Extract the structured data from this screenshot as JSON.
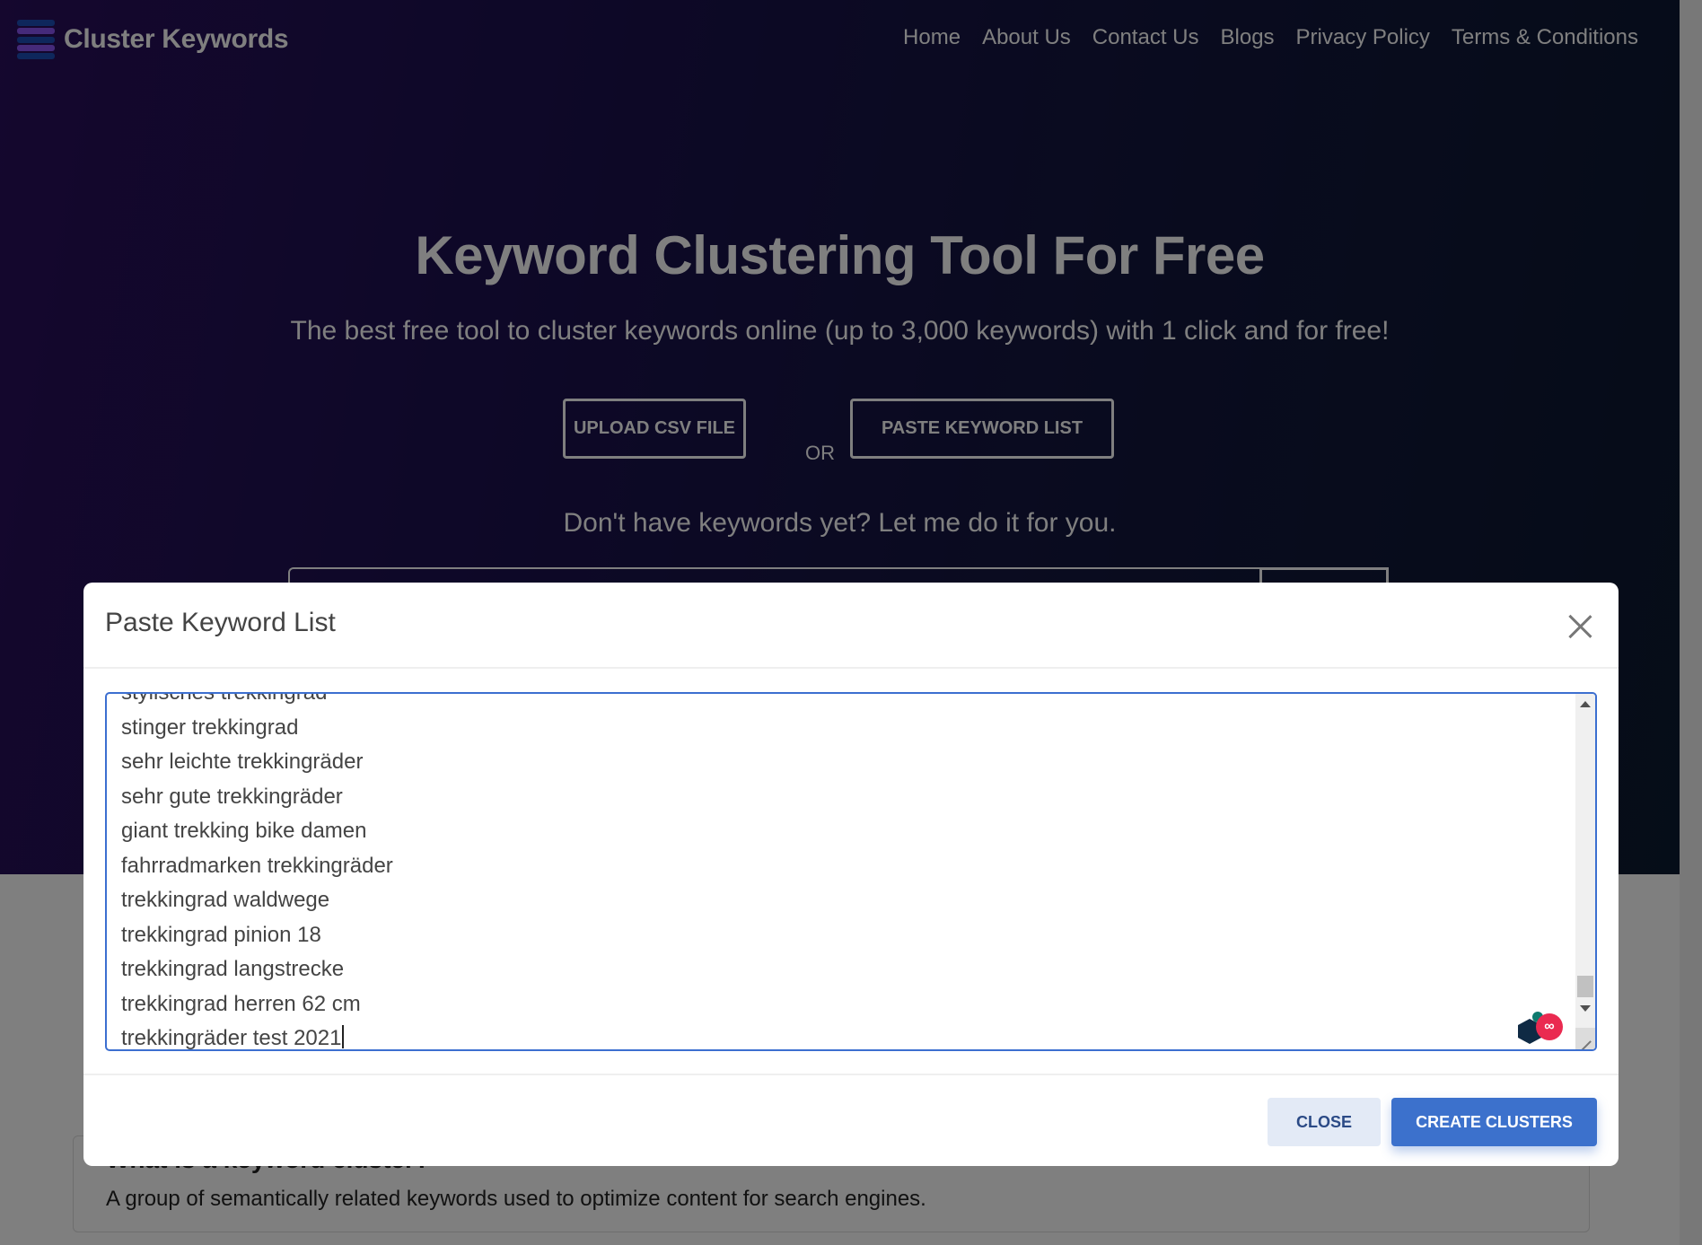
{
  "site": {
    "logo_text": "Cluster Keywords",
    "nav": [
      "Home",
      "About Us",
      "Contact Us",
      "Blogs",
      "Privacy Policy",
      "Terms & Conditions"
    ]
  },
  "hero": {
    "title": "Keyword Clustering Tool For Free",
    "subtitle": "The best free tool to cluster keywords online (up to 3,000 keywords) with 1 click and for free!",
    "upload_label": "UPLOAD CSV FILE",
    "or_label": "OR",
    "paste_label": "PASTE KEYWORD LIST",
    "prompt": "Don't have keywords yet? Let me do it for you."
  },
  "info_card": {
    "title": "What is a keyword cluster?",
    "text": "A group of semantically related keywords used to optimize content for search engines."
  },
  "modal": {
    "title": "Paste Keyword List",
    "keywords": [
      "stylisches trekkingrad",
      "stinger trekkingrad",
      "sehr leichte trekkingräder",
      "sehr gute trekkingräder",
      "giant trekking bike damen",
      "fahrradmarken trekkingräder",
      "trekkingrad waldwege",
      "trekkingrad pinion 18",
      "trekkingrad langstrecke",
      "trekkingrad herren 62 cm",
      "trekkingräder test 2021"
    ],
    "scroll_position": 1.0,
    "close_label": "CLOSE",
    "create_label": "CREATE CLUSTERS"
  },
  "colors": {
    "accent": "#3c71cc",
    "textarea_border": "#3c6fd0",
    "close_bg": "#e3eaf6",
    "logo_blue": "#1d4fb8",
    "logo_purple": "#8a55f5"
  }
}
